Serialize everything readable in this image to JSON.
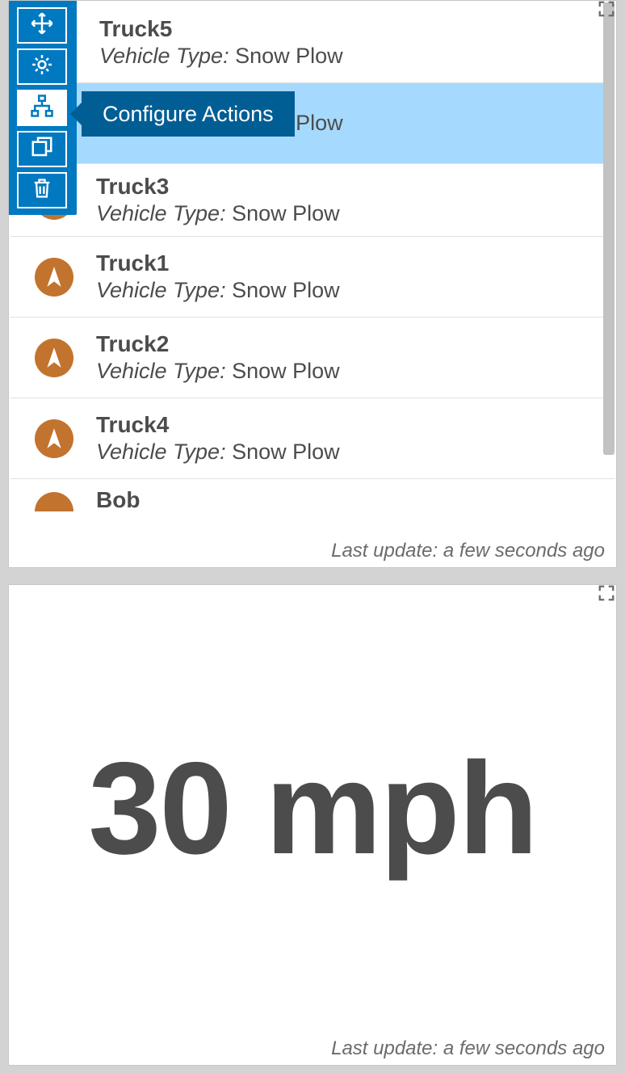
{
  "colors": {
    "toolbar_bg": "#0079C1",
    "tooltip_bg": "#005E95",
    "highlight_bg": "#A6D9FE",
    "icon_bg": "#C2732D",
    "text": "#4c4c4c"
  },
  "toolbar": {
    "items": [
      {
        "name": "move-icon",
        "active": false
      },
      {
        "name": "gear-icon",
        "active": false
      },
      {
        "name": "sitemap-icon",
        "active": true
      },
      {
        "name": "copy-icon",
        "active": false
      },
      {
        "name": "trash-icon",
        "active": false
      }
    ],
    "tooltip": "Configure Actions"
  },
  "list_panel": {
    "subtitle_prefix": "Vehicle Type:",
    "items": [
      {
        "title": "Truck5",
        "vehicle_type": "Snow Plow",
        "icon": false,
        "highlighted": false
      },
      {
        "title": "",
        "vehicle_type": "Snow Plow",
        "icon": false,
        "highlighted": true
      },
      {
        "title": "Truck3",
        "vehicle_type": "Snow Plow",
        "icon": true,
        "highlighted": false
      },
      {
        "title": "Truck1",
        "vehicle_type": "Snow Plow",
        "icon": true,
        "highlighted": false
      },
      {
        "title": "Truck2",
        "vehicle_type": "Snow Plow",
        "icon": true,
        "highlighted": false
      },
      {
        "title": "Truck4",
        "vehicle_type": "Snow Plow",
        "icon": true,
        "highlighted": false
      },
      {
        "title": "Bob",
        "vehicle_type": "",
        "icon": true,
        "highlighted": false
      }
    ],
    "last_update": "Last update: a few seconds ago"
  },
  "speed_panel": {
    "display": "30 mph",
    "last_update": "Last update: a few seconds ago"
  }
}
